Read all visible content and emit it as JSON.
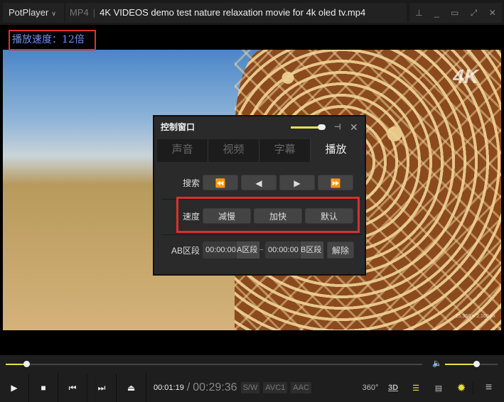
{
  "app": {
    "name": "PotPlayer",
    "format": "MP4",
    "title": "4K VIDEOS demo test nature relaxation movie for 4k oled tv.mp4"
  },
  "window_buttons": [
    "pin-icon",
    "minimize-icon",
    "maximize-icon",
    "fullscreen-icon",
    "close-icon"
  ],
  "osd": "播放速度：12倍",
  "video": {
    "logo": "4K",
    "resolution": "15,360 × 2,160 px"
  },
  "control_window": {
    "title": "控制窗口",
    "opacity_level": 0.9,
    "tabs": [
      {
        "label": "声音"
      },
      {
        "label": "视频"
      },
      {
        "label": "字幕"
      },
      {
        "label": "播放",
        "active": true
      }
    ],
    "seek_label": "搜索",
    "seek_buttons": [
      "⏪",
      "◀",
      "▶",
      "⏩"
    ],
    "speed_label": "速度",
    "speed_buttons": [
      "减慢",
      "加快",
      "默认"
    ],
    "ab_label": "AB区段",
    "a_time": "00:00:00",
    "a_button": "A区段",
    "tilde": "~",
    "b_time": "00:00:00",
    "b_button": "B区段",
    "clear_button": "解除"
  },
  "player": {
    "progress_percent": 5,
    "volume_percent": 60,
    "current_time": "00:01:19",
    "separator": "/",
    "duration": "00:29:36",
    "tags": [
      "S/W",
      "AVC1",
      "AAC"
    ],
    "right_buttons": {
      "vr": "360°",
      "3d": "3D"
    }
  },
  "colors": {
    "accent": "#e8e040",
    "highlight": "#d83030",
    "osd_text": "#6f8ff0"
  }
}
